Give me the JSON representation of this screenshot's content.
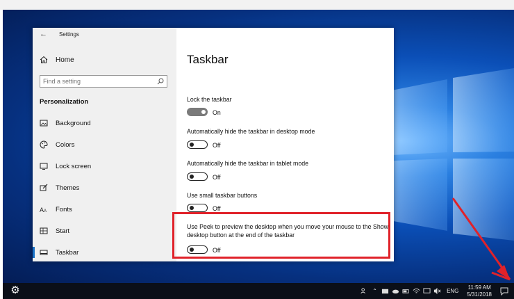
{
  "window": {
    "title": "Settings",
    "back_icon": "back-arrow-icon"
  },
  "sidebar": {
    "home_label": "Home",
    "search_placeholder": "Find a setting",
    "section_title": "Personalization",
    "items": [
      {
        "label": "Background",
        "icon": "picture-icon"
      },
      {
        "label": "Colors",
        "icon": "palette-icon"
      },
      {
        "label": "Lock screen",
        "icon": "monitor-lock-icon"
      },
      {
        "label": "Themes",
        "icon": "brush-icon"
      },
      {
        "label": "Fonts",
        "icon": "fonts-icon"
      },
      {
        "label": "Start",
        "icon": "start-tiles-icon"
      },
      {
        "label": "Taskbar",
        "icon": "taskbar-icon",
        "active": true
      }
    ]
  },
  "main": {
    "title": "Taskbar",
    "settings": [
      {
        "label": "Lock the taskbar",
        "state": "On",
        "on": true
      },
      {
        "label": "Automatically hide the taskbar in desktop mode",
        "state": "Off",
        "on": false
      },
      {
        "label": "Automatically hide the taskbar in tablet mode",
        "state": "Off",
        "on": false
      },
      {
        "label": "Use small taskbar buttons",
        "state": "Off",
        "on": false
      },
      {
        "label": "Use Peek to preview the desktop when you move your mouse to the Show desktop button at the end of the taskbar",
        "state": "Off",
        "on": false
      }
    ]
  },
  "taskbar": {
    "language": "ENG",
    "time": "11:59 AM",
    "date": "5/31/2018"
  },
  "colors": {
    "highlight_box": "#e0222a",
    "annotation_arrow": "#e0222a",
    "accent": "#1a73c7",
    "toggle_on": "#7a7a7a"
  }
}
